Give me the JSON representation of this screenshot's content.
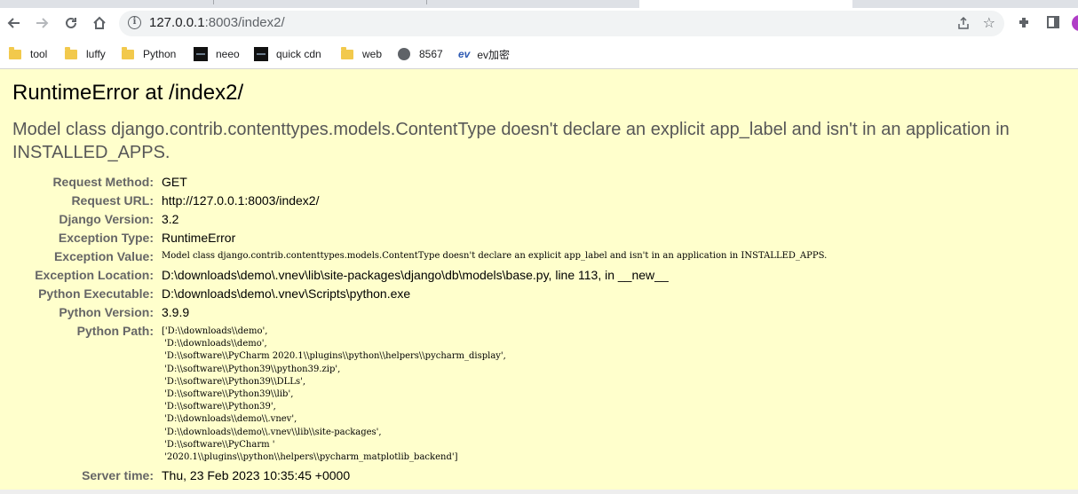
{
  "browser": {
    "url_host": "127.0.0.1",
    "url_path": ":8003/index2/",
    "bookmarks": [
      {
        "label": "tool",
        "icon": "folder-icon"
      },
      {
        "label": "luffy",
        "icon": "folder-icon"
      },
      {
        "label": "Python",
        "icon": "folder-icon"
      },
      {
        "label": "neeo",
        "icon": "site-icon"
      },
      {
        "label": "quick cdn",
        "icon": "site-icon"
      },
      {
        "label": "web",
        "icon": "folder-icon"
      },
      {
        "label": "8567",
        "icon": "globe-icon"
      },
      {
        "label": "ev加密",
        "icon": "ev-icon"
      }
    ]
  },
  "error": {
    "title": "RuntimeError at /index2/",
    "message": "Model class django.contrib.contenttypes.models.ContentType doesn't declare an explicit app_label and isn't in an application in INSTALLED_APPS.",
    "rows": [
      {
        "label": "Request Method:",
        "value": "GET"
      },
      {
        "label": "Request URL:",
        "value": "http://127.0.0.1:8003/index2/"
      },
      {
        "label": "Django Version:",
        "value": "3.2"
      },
      {
        "label": "Exception Type:",
        "value": "RuntimeError"
      },
      {
        "label": "Exception Value:",
        "value": "Model class django.contrib.contenttypes.models.ContentType doesn't declare an explicit app_label and isn't in an application in INSTALLED_APPS."
      },
      {
        "label": "Exception Location:",
        "value": "D:\\downloads\\demo\\.vnev\\lib\\site-packages\\django\\db\\models\\base.py, line 113, in __new__"
      },
      {
        "label": "Python Executable:",
        "value": "D:\\downloads\\demo\\.vnev\\Scripts\\python.exe"
      },
      {
        "label": "Python Version:",
        "value": "3.9.9"
      }
    ],
    "python_path_label": "Python Path:",
    "python_path": "['D:\\\\downloads\\\\demo',\n 'D:\\\\downloads\\\\demo',\n 'D:\\\\software\\\\PyCharm 2020.1\\\\plugins\\\\python\\\\helpers\\\\pycharm_display',\n 'D:\\\\software\\\\Python39\\\\python39.zip',\n 'D:\\\\software\\\\Python39\\\\DLLs',\n 'D:\\\\software\\\\Python39\\\\lib',\n 'D:\\\\software\\\\Python39',\n 'D:\\\\downloads\\\\demo\\\\.vnev',\n 'D:\\\\downloads\\\\demo\\\\.vnev\\\\lib\\\\site-packages',\n 'D:\\\\software\\\\PyCharm '\n '2020.1\\\\plugins\\\\python\\\\helpers\\\\pycharm_matplotlib_backend']",
    "server_time_label": "Server time:",
    "server_time": "Thu, 23 Feb 2023 10:35:45 +0000"
  }
}
